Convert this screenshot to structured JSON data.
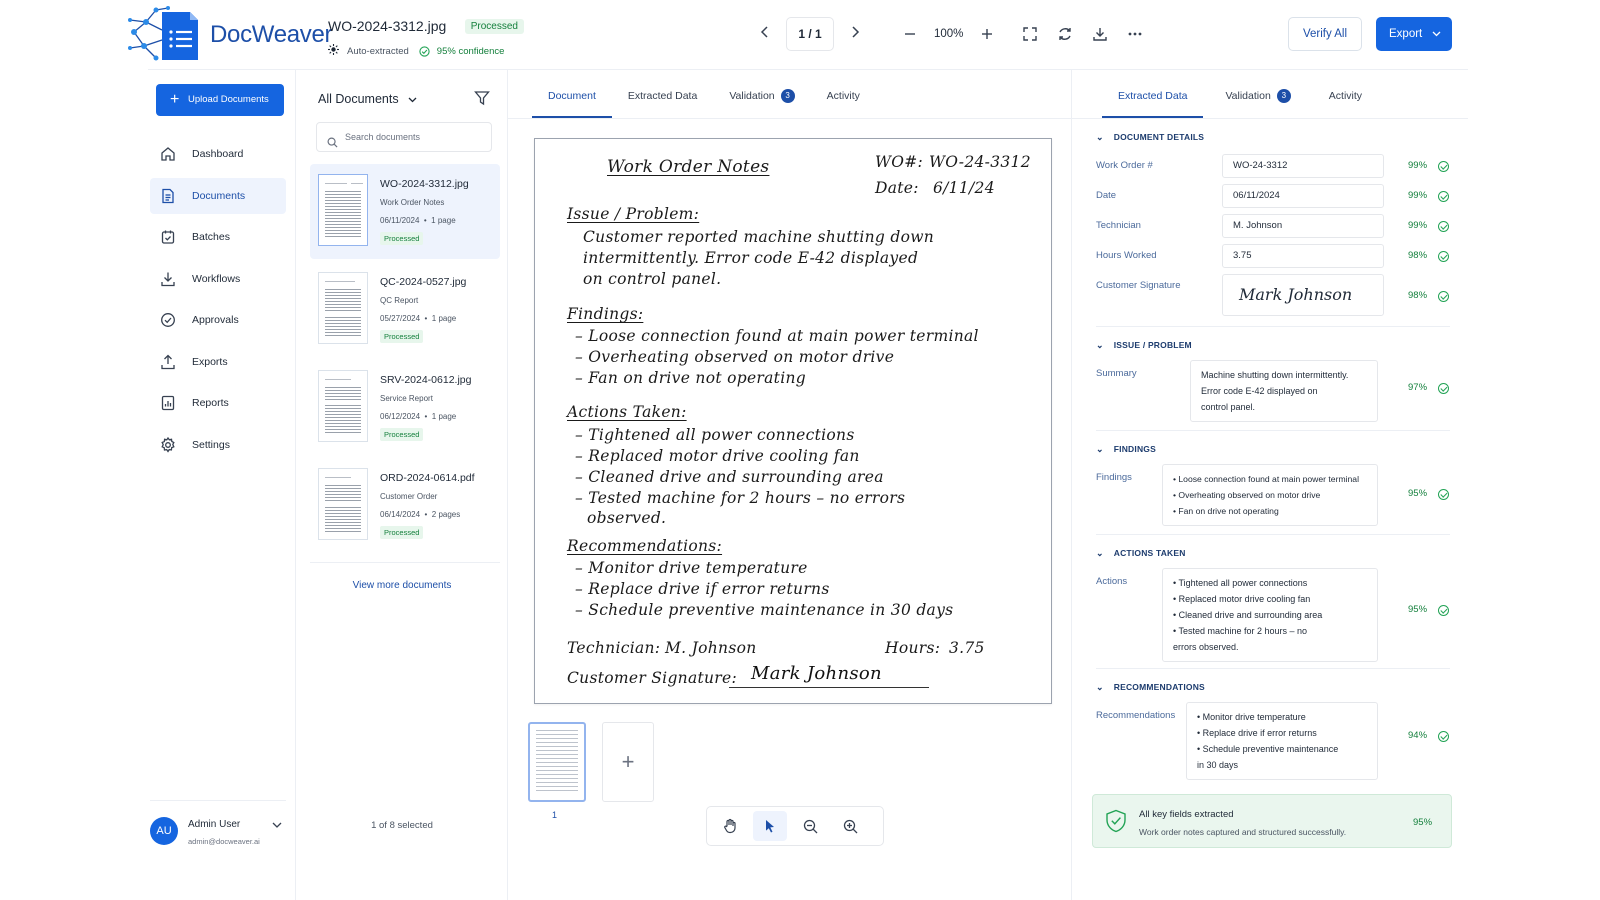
{
  "app": {
    "logo_text": "DocWeaver"
  },
  "file": {
    "name": "WO-2024-3312.jpg",
    "status": "Processed",
    "auto_label": "Auto-extracted",
    "confidence": "95% confidence"
  },
  "pager": {
    "label": "1 / 1"
  },
  "zoom": {
    "value": "100%"
  },
  "actions": {
    "verify": "Verify All",
    "export": "Export"
  },
  "nav": {
    "upload": "Upload Documents",
    "items": [
      {
        "label": "Dashboard",
        "icon": "home-icon"
      },
      {
        "label": "Documents",
        "icon": "documents-icon"
      },
      {
        "label": "Batches",
        "icon": "batches-icon"
      },
      {
        "label": "Workflows",
        "icon": "workflows-icon"
      },
      {
        "label": "Approvals",
        "icon": "approvals-icon"
      },
      {
        "label": "Exports",
        "icon": "exports-icon"
      },
      {
        "label": "Reports",
        "icon": "reports-icon"
      },
      {
        "label": "Settings",
        "icon": "gear-icon"
      }
    ],
    "active": "Documents"
  },
  "user": {
    "initials": "AU",
    "name": "Admin User",
    "email": "admin@docweaver.ai"
  },
  "doclist": {
    "title": "All Documents",
    "search_placeholder": "Search documents",
    "docs": [
      {
        "name": "WO-2024-3312.jpg",
        "type": "Work Order Notes",
        "date": "06/11/2024",
        "pages": "1 page",
        "status": "Processed"
      },
      {
        "name": "QC-2024-0527.jpg",
        "type": "QC Report",
        "date": "05/27/2024",
        "pages": "1 page",
        "status": "Processed"
      },
      {
        "name": "SRV-2024-0612.jpg",
        "type": "Service Report",
        "date": "06/12/2024",
        "pages": "1 page",
        "status": "Processed"
      },
      {
        "name": "ORD-2024-0614.pdf",
        "type": "Customer Order",
        "date": "06/14/2024",
        "pages": "2 pages",
        "status": "Processed"
      }
    ],
    "meta_sep": "•",
    "more": "View more documents",
    "count": "1 of 8 selected"
  },
  "viewer": {
    "tabs": [
      "Document",
      "Extracted Data",
      "Validation",
      "Activity"
    ],
    "validation_count": "3",
    "page_number": "1"
  },
  "note": {
    "title": "Work Order Notes",
    "wo_label": "WO#:",
    "wo_value": "WO-24-3312",
    "date_label": "Date:",
    "date_value": "6/11/24",
    "issue_heading": "Issue / Problem:",
    "issue_lines": [
      "Customer reported machine shutting down",
      "intermittently. Error code E-42 displayed",
      "on control panel."
    ],
    "findings_heading": "Findings:",
    "findings": [
      "– Loose connection found at main power terminal",
      "– Overheating observed on motor drive",
      "– Fan on drive not operating"
    ],
    "actions_heading": "Actions Taken:",
    "actions": [
      "– Tightened all power connections",
      "– Replaced motor drive cooling fan",
      "– Cleaned drive and surrounding area",
      "– Tested machine for 2 hours – no errors",
      "   observed."
    ],
    "rec_heading": "Recommendations:",
    "recs": [
      "– Monitor drive temperature",
      "– Replace drive if error returns",
      "– Schedule preventive maintenance in 30 days"
    ],
    "tech_label": "Technician:",
    "tech_value": "M. Johnson",
    "hours_label": "Hours:",
    "hours_value": "3.75",
    "sig_label": "Customer Signature:",
    "sig_value": "Mark Johnson"
  },
  "panel": {
    "tabs": [
      "Extracted Data",
      "Validation",
      "Activity"
    ],
    "validation_count": "3",
    "sections": {
      "details": "DOCUMENT DETAILS",
      "issue": "ISSUE / PROBLEM",
      "findings": "FINDINGS",
      "actions": "ACTIONS TAKEN",
      "recs": "RECOMMENDATIONS"
    },
    "fields": [
      {
        "label": "Work Order #",
        "value": "WO-24-3312",
        "conf": "99%"
      },
      {
        "label": "Date",
        "value": "06/11/2024",
        "conf": "99%"
      },
      {
        "label": "Technician",
        "value": "M. Johnson",
        "conf": "99%"
      },
      {
        "label": "Hours Worked",
        "value": "3.75",
        "conf": "98%"
      },
      {
        "label": "Customer Signature",
        "value": "Mark Johnson",
        "conf": "98%"
      }
    ],
    "summary": {
      "label": "Summary",
      "lines": [
        "Machine shutting down intermittently.",
        "Error code E-42 displayed on",
        "control panel."
      ],
      "conf": "97%"
    },
    "findings": {
      "label": "Findings",
      "lines": [
        "• Loose connection found at main power terminal",
        "• Overheating observed on motor drive",
        "• Fan on drive not operating"
      ],
      "conf": "95%"
    },
    "actions": {
      "label": "Actions",
      "lines": [
        "• Tightened all power connections",
        "• Replaced motor drive cooling fan",
        "• Cleaned drive and surrounding area",
        "• Tested machine for 2 hours – no",
        "   errors observed."
      ],
      "conf": "95%"
    },
    "recs": {
      "label": "Recommendations",
      "lines": [
        "• Monitor drive temperature",
        "• Replace drive if error returns",
        "• Schedule preventive maintenance",
        "   in 30 days"
      ],
      "conf": "94%"
    },
    "success": {
      "title": "All key fields extracted",
      "subtitle": "Work order notes captured and structured successfully.",
      "conf": "95%"
    }
  },
  "colors": {
    "accent": "#1565e0",
    "success": "#15803d",
    "brand": "#1d4fa8"
  }
}
